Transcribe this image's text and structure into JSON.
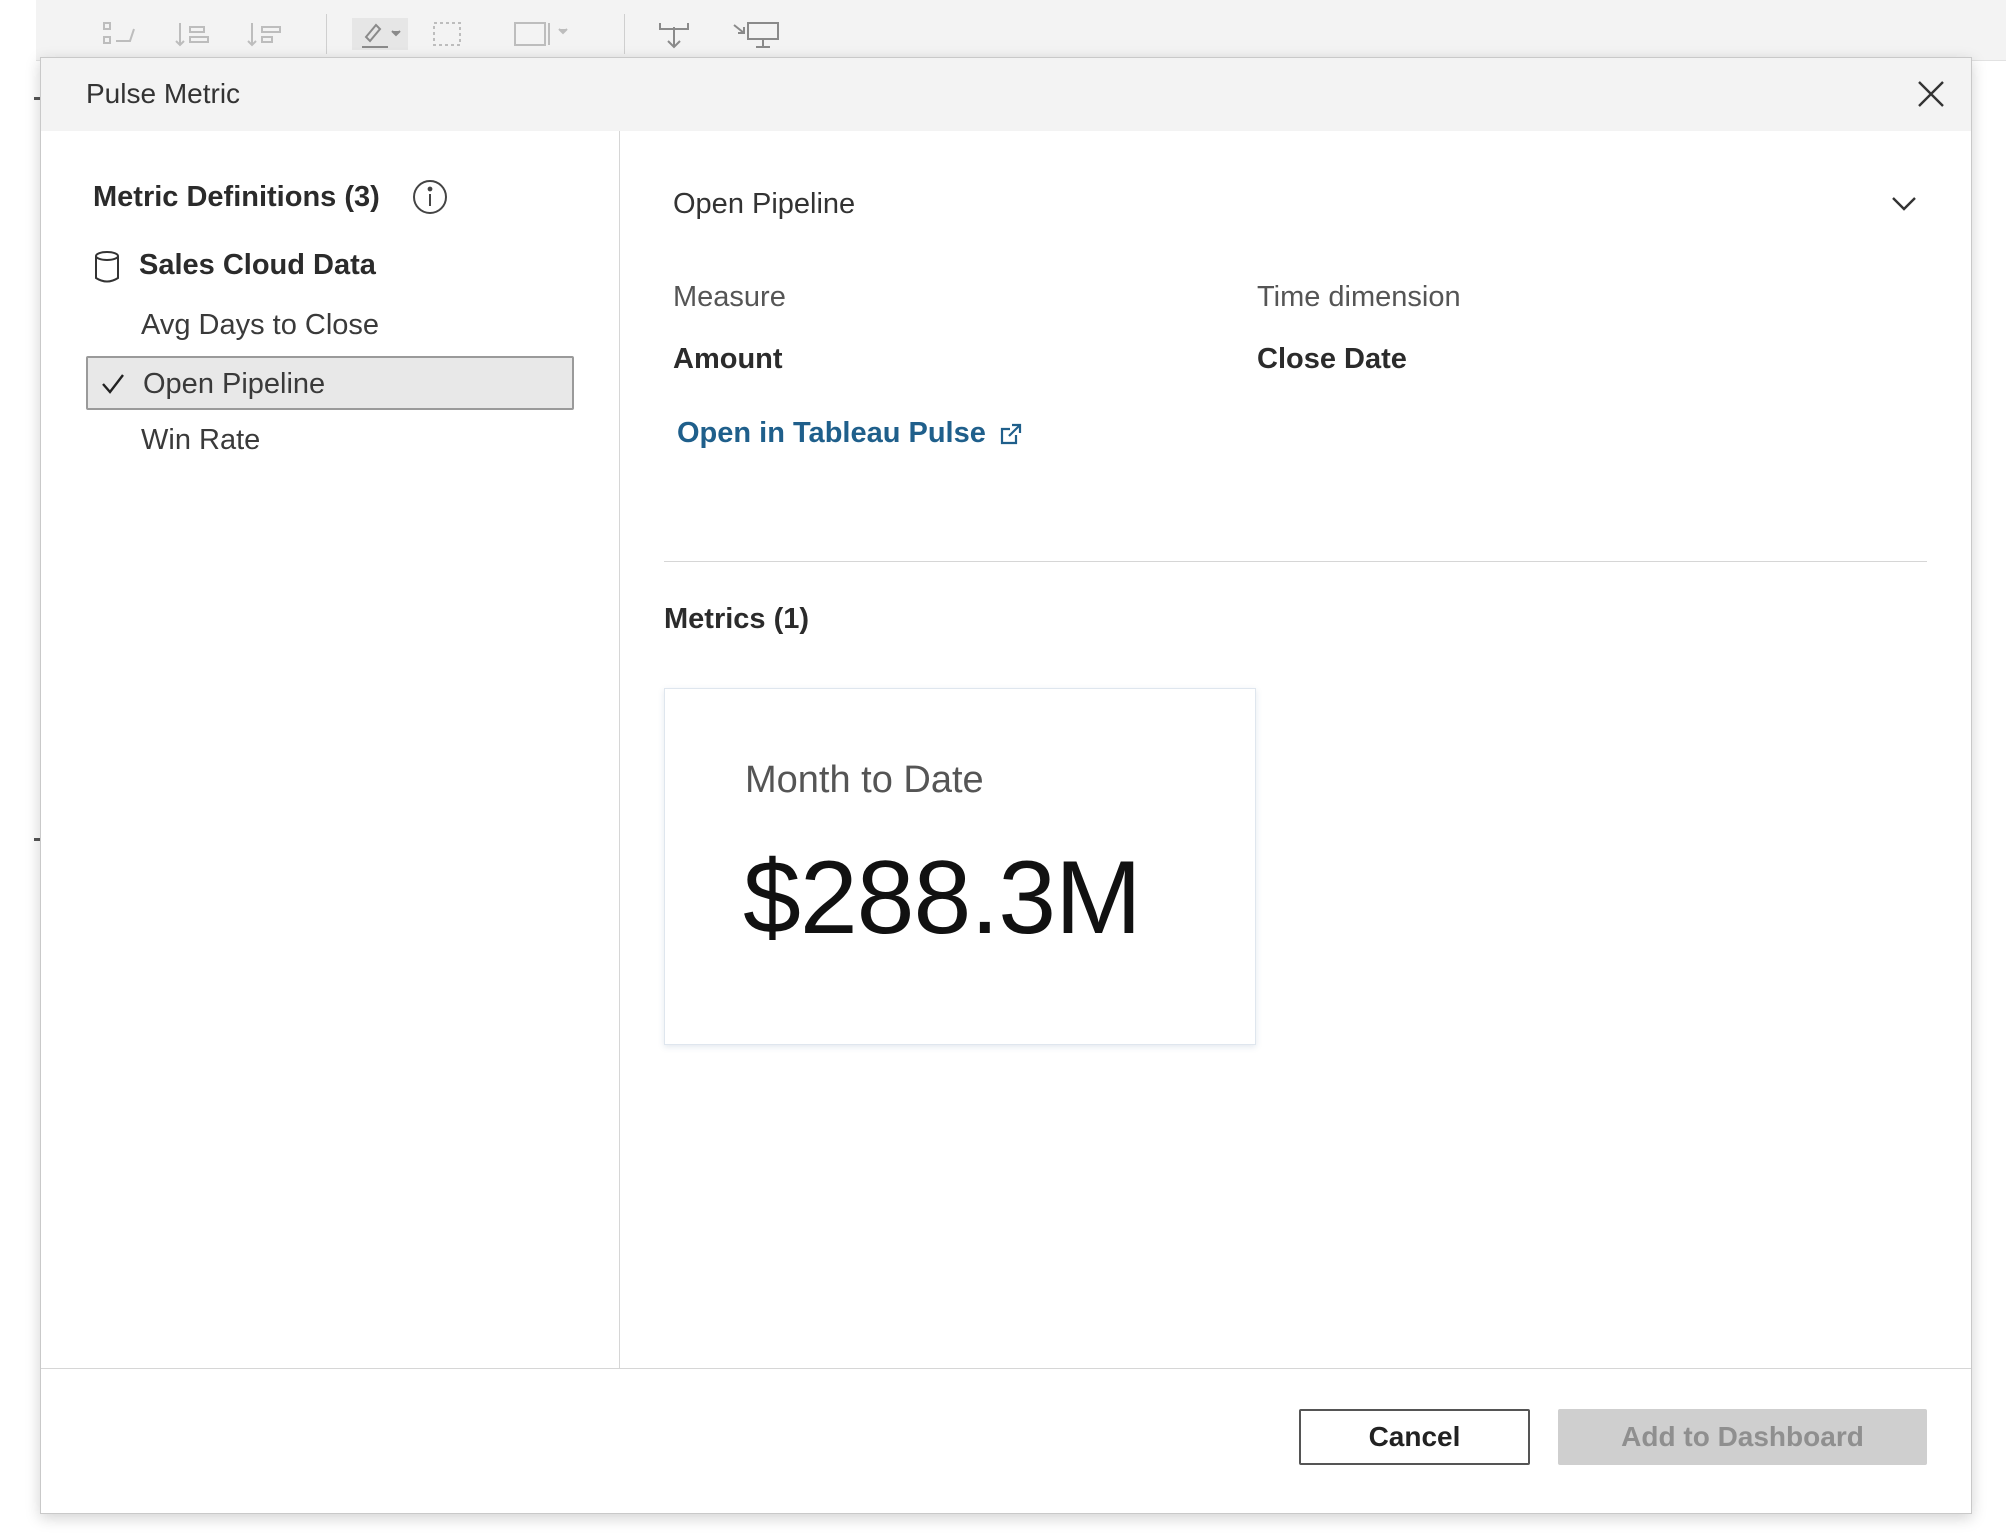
{
  "dialog": {
    "title": "Pulse Metric"
  },
  "sidebar": {
    "heading": "Metric Definitions (3)",
    "datasource": "Sales Cloud Data",
    "items": [
      {
        "label": "Avg Days to Close",
        "selected": false
      },
      {
        "label": "Open Pipeline",
        "selected": true
      },
      {
        "label": "Win Rate",
        "selected": false
      }
    ]
  },
  "detail": {
    "selected_metric": "Open Pipeline",
    "measure_label": "Measure",
    "measure_value": "Amount",
    "time_label": "Time dimension",
    "time_value": "Close Date",
    "link_label": "Open in Tableau Pulse",
    "metrics_heading": "Metrics (1)",
    "card": {
      "period": "Month to Date",
      "value": "$288.3M"
    }
  },
  "footer": {
    "cancel_label": "Cancel",
    "add_label": "Add to Dashboard"
  },
  "colors": {
    "link": "#1f5f8b",
    "selected_bg": "#e8e8e8",
    "disabled_button": "#cfcfcf"
  },
  "icons": [
    "info-icon",
    "database-icon",
    "check-icon",
    "chevron-down-icon",
    "external-link-icon",
    "close-icon"
  ]
}
